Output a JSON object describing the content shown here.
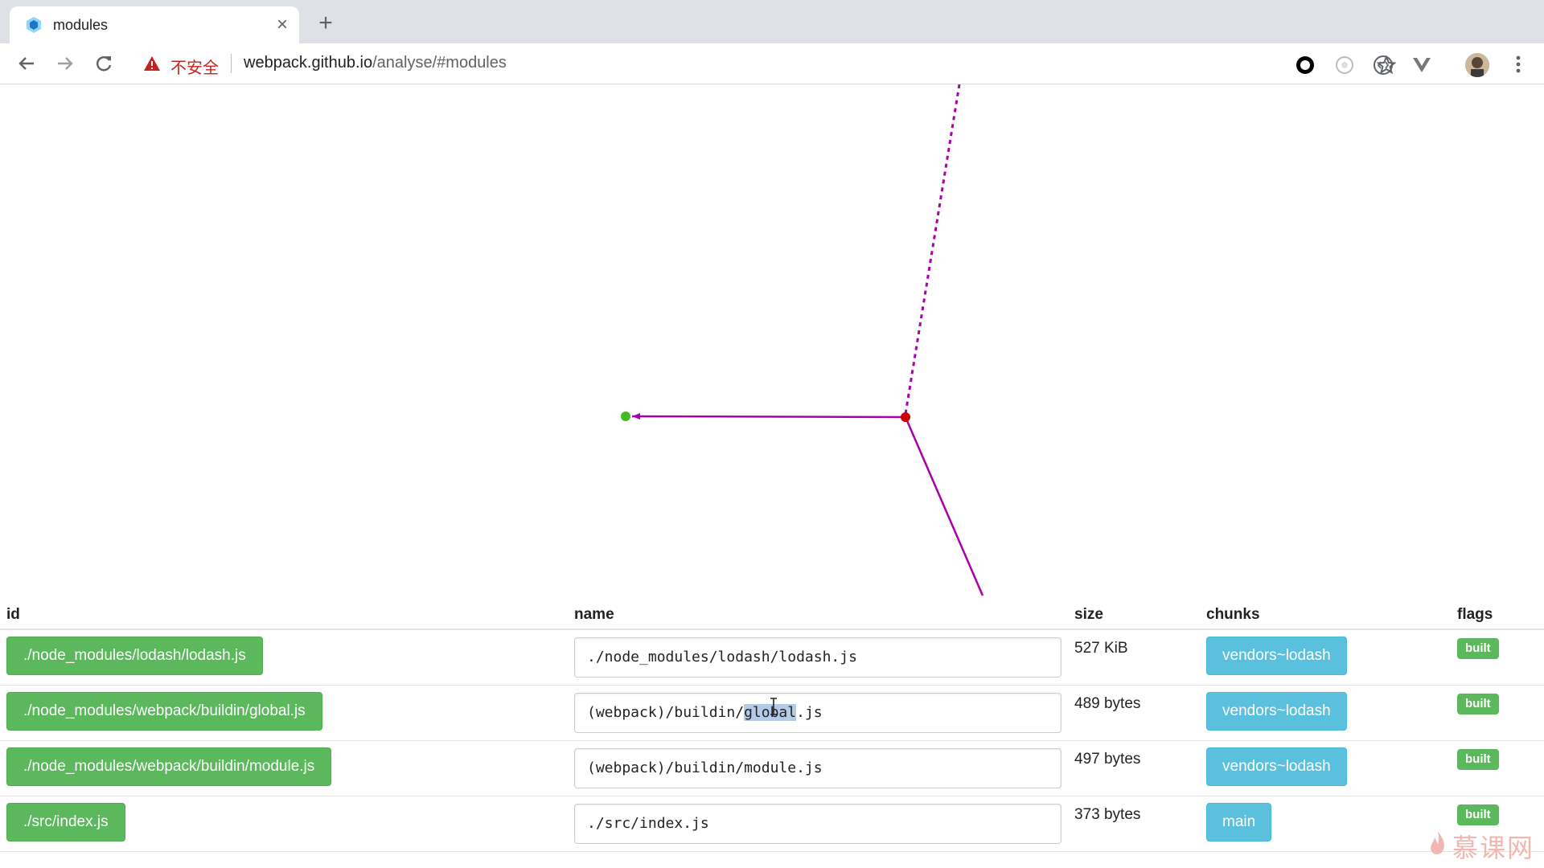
{
  "browser": {
    "tab_title": "modules",
    "security_label": "不安全",
    "url_host": "webpack.github.io",
    "url_path": "/analyse/#modules"
  },
  "table": {
    "headers": {
      "id": "id",
      "name": "name",
      "size": "size",
      "chunks": "chunks",
      "flags": "flags"
    },
    "rows": [
      {
        "id": "./node_modules/lodash/lodash.js",
        "name": "./node_modules/lodash/lodash.js",
        "size": "527 KiB",
        "chunk": "vendors~lodash",
        "flag": "built"
      },
      {
        "id": "./node_modules/webpack/buildin/global.js",
        "name_pre": "(webpack)/buildin/",
        "name_sel": "global",
        "name_post": ".js",
        "size": "489 bytes",
        "chunk": "vendors~lodash",
        "flag": "built"
      },
      {
        "id": "./node_modules/webpack/buildin/module.js",
        "name": "(webpack)/buildin/module.js",
        "size": "497 bytes",
        "chunk": "vendors~lodash",
        "flag": "built"
      },
      {
        "id": "./src/index.js",
        "name": "./src/index.js",
        "size": "373 bytes",
        "chunk": "main",
        "flag": "built"
      }
    ]
  },
  "watermark": "慕课网",
  "colors": {
    "id_button": "#5cb85c",
    "chunk_button": "#5bc0de",
    "flag_badge": "#5cb85c",
    "graph_edge": "#aa00aa",
    "graph_node_center": "#cc0000",
    "graph_node_leaf": "#44bb22"
  }
}
